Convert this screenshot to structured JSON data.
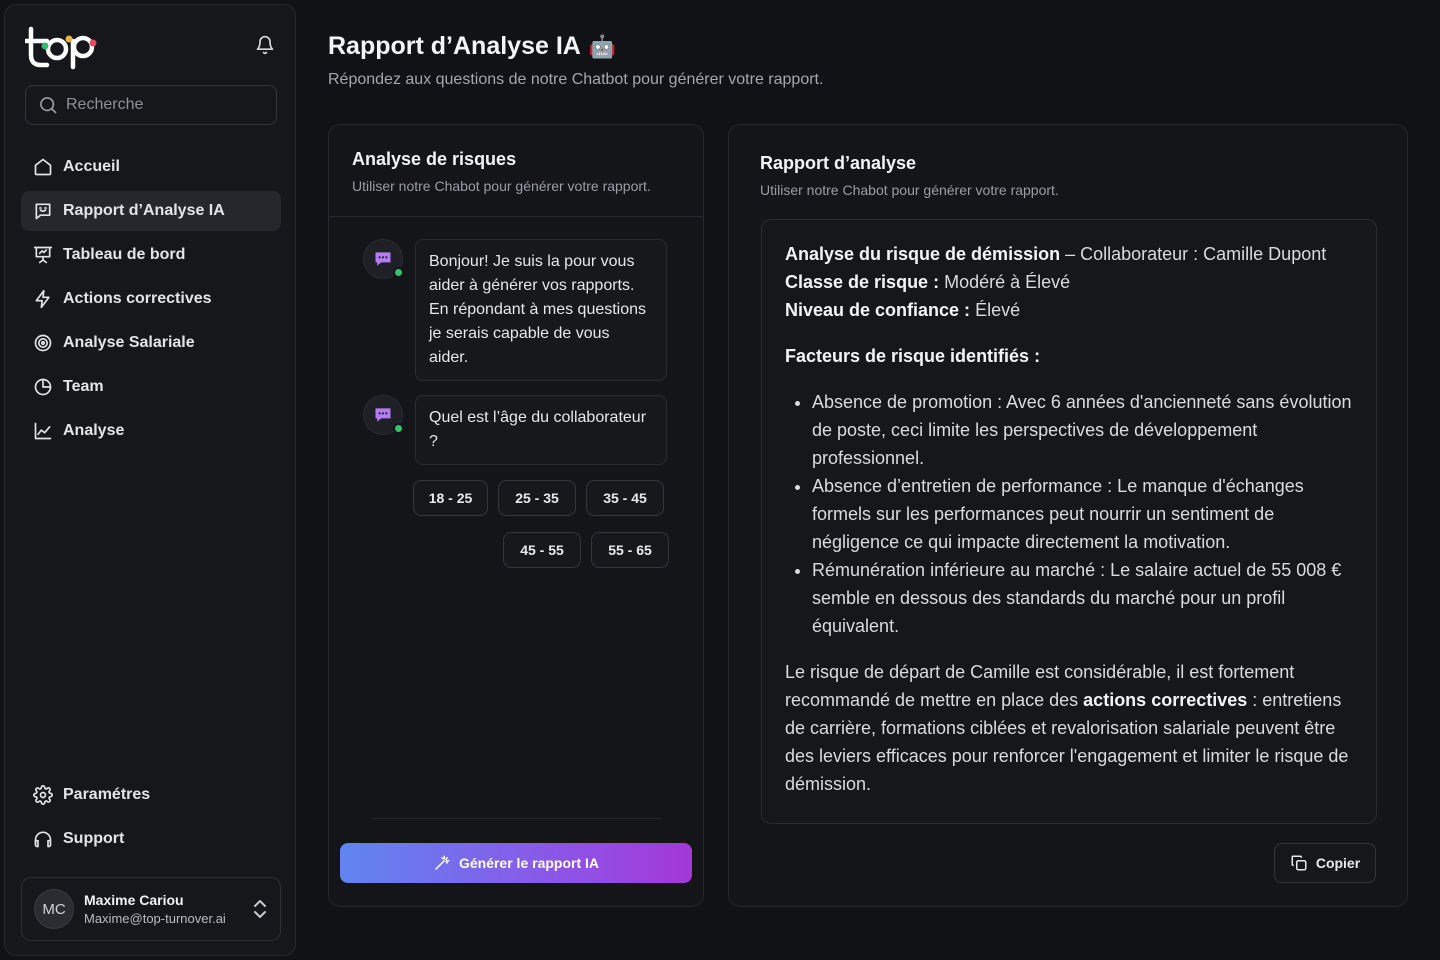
{
  "sidebar": {
    "search_placeholder": "Recherche",
    "nav_top": [
      {
        "label": "Accueil",
        "icon": "home-icon"
      },
      {
        "label": "Rapport d’Analyse IA",
        "icon": "chat-icon",
        "active": true
      },
      {
        "label": "Tableau de bord",
        "icon": "presentation-icon"
      },
      {
        "label": "Actions correctives",
        "icon": "lightning-icon"
      },
      {
        "label": "Analyse Salariale",
        "icon": "target-icon"
      },
      {
        "label": "Team",
        "icon": "pie-icon"
      },
      {
        "label": "Analyse",
        "icon": "line-chart-icon"
      }
    ],
    "nav_bottom": [
      {
        "label": "Paramétres",
        "icon": "gear-icon"
      },
      {
        "label": "Support",
        "icon": "support-icon"
      }
    ],
    "user": {
      "initials": "MC",
      "name": "Maxime Cariou",
      "email": "Maxime@top-turnover.ai"
    }
  },
  "header": {
    "title": "Rapport d’Analyse IA",
    "emoji": "🤖",
    "subtitle": "Répondez aux questions de notre Chatbot pour générer votre rapport."
  },
  "chat": {
    "title": "Analyse de risques",
    "subtitle": "Utiliser notre Chabot pour générer votre rapport.",
    "messages": [
      "Bonjour! Je suis la pour vous aider à générer vos rapports. En répondant à mes questions je serais capable de vous aider.",
      "Quel est l’âge du collaborateur ?"
    ],
    "options_row1": [
      "18 - 25",
      "25 - 35",
      "35 - 45"
    ],
    "options_row2": [
      "45 - 55",
      "55 - 65"
    ],
    "generate_label": "Générer le rapport IA"
  },
  "report": {
    "title": "Rapport d’analyse",
    "subtitle": "Utiliser notre Chabot pour générer votre rapport.",
    "line1_bold": "Analyse du risque de démission",
    "line1_rest": " – Collaborateur : Camille Dupont",
    "line2_bold": "Classe de risque :",
    "line2_rest": " Modéré à Élevé",
    "line3_bold": "Niveau de confiance :",
    "line3_rest": " Élevé",
    "factors_title": "Facteurs de risque identifiés :",
    "factors": [
      "Absence de promotion : Avec 6 années d'ancienneté sans évolution de poste, ceci limite les perspectives de développement professionnel.",
      "Absence d’entretien de performance : Le manque d'échanges formels sur les performances peut nourrir un sentiment de négligence ce qui impacte directement la motivation.",
      "Rémunération inférieure au marché : Le salaire actuel de 55 008 € semble en dessous des standards du marché pour un profil équivalent."
    ],
    "conclusion_a": "Le risque de départ de Camille est considérable, il est fortement recommandé de mettre en place des ",
    "conclusion_bold": "actions correctives",
    "conclusion_b": " : entretiens de carrière, formations ciblées et revalorisation salariale peuvent être des leviers efficaces pour renforcer l'engagement et limiter le risque de démission.",
    "copy_label": "Copier"
  },
  "colors": {
    "background": "#111215",
    "online": "#31c46c",
    "bot_icon": "#b57cf2",
    "gradient_start": "#5f86f0",
    "gradient_end": "#a437d8"
  }
}
